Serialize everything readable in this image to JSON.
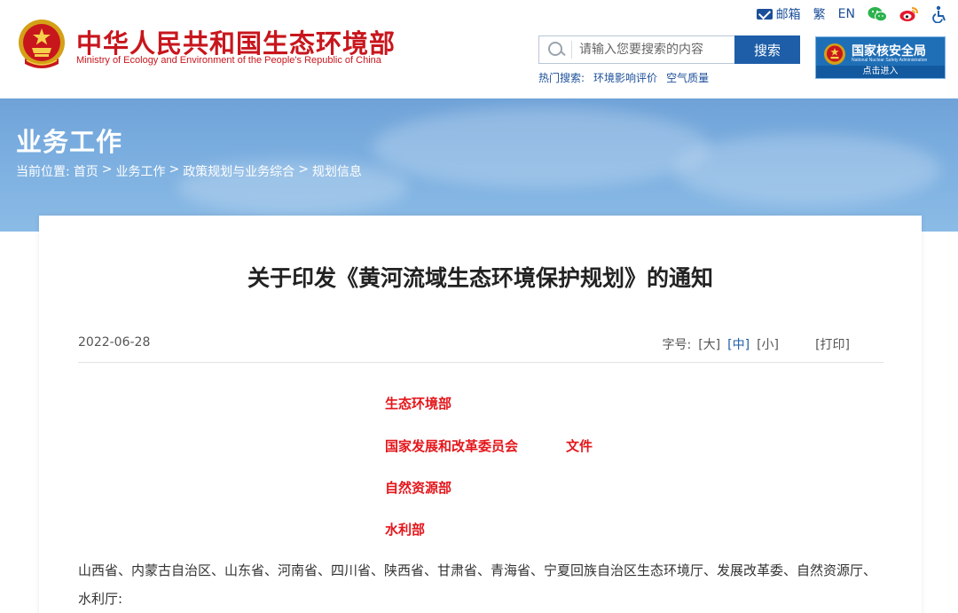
{
  "header": {
    "title_cn": "中华人民共和国生态环境部",
    "title_en": "Ministry of Ecology and Environment of the People's Republic of China",
    "toplinks": {
      "mail": "邮箱",
      "traditional": "繁",
      "english": "EN"
    },
    "search": {
      "placeholder": "请输入您要搜索的内容",
      "button": "搜索",
      "hot_label": "热门搜索:",
      "hot_items": [
        "环境影响评价",
        "空气质量"
      ]
    },
    "nnsa": {
      "title": "国家核安全局",
      "subtitle": "National Nuclear Safety Administration",
      "enter": "点击进入"
    }
  },
  "banner": {
    "title": "业务工作",
    "breadcrumb_prefix": "当前位置:",
    "breadcrumb": [
      "首页",
      "业务工作",
      "政策规划与业务综合",
      "规划信息"
    ],
    "separator": ">"
  },
  "article": {
    "title": "关于印发《黄河流域生态环境保护规划》的通知",
    "date": "2022-06-28",
    "font_label": "字号:",
    "font_options": [
      "[大]",
      "[中]",
      "[小]"
    ],
    "print": "[打印]",
    "issuers": [
      "生态环境部",
      "国家发展和改革委员会",
      "自然资源部",
      "水利部"
    ],
    "issuer_doc": "文件",
    "body": "山西省、内蒙古自治区、山东省、河南省、四川省、陕西省、甘肃省、青海省、宁夏回族自治区生态环境厅、发展改革委、自然资源厅、水利厅:"
  },
  "colors": {
    "brand_red": "#c8161d",
    "link_blue": "#1c4f9a",
    "button_blue": "#1e5ea8",
    "issuer_red": "#e4161b"
  }
}
